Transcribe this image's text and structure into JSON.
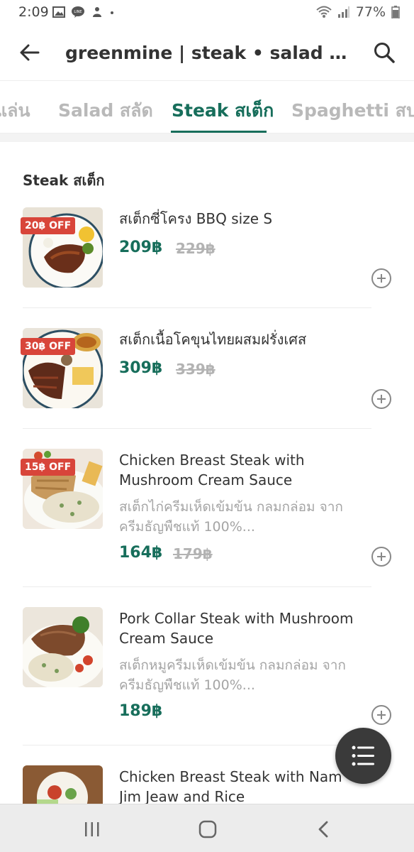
{
  "status_bar": {
    "time": "2:09",
    "battery": "77%",
    "left_icons": [
      "gallery-icon",
      "line-icon",
      "notification-icon",
      "dot-icon"
    ],
    "right_icons": [
      "wifi-icon",
      "signal-icon",
      "battery-icon"
    ]
  },
  "header": {
    "title": "greenmine | steak • salad • coff..."
  },
  "tabs": [
    {
      "label": "แล่น"
    },
    {
      "label": "Salad สลัด"
    },
    {
      "label": "Steak สเต็ก",
      "active": true
    },
    {
      "label": "Spaghetti สปา"
    }
  ],
  "section": {
    "title": "Steak สเต็ก"
  },
  "items": [
    {
      "badge": "20฿ OFF",
      "name": "สเต็กซี่โครง BBQ size S",
      "description": "",
      "price": "209฿",
      "old_price": "229฿"
    },
    {
      "badge": "30฿ OFF",
      "name": "สเต็กเนื้อโคขุนไทยผสมฝรั่งเศส",
      "description": "",
      "price": "309฿",
      "old_price": "339฿"
    },
    {
      "badge": "15฿ OFF",
      "name": "Chicken Breast Steak with Mushroom Cream Sauce",
      "description": "สเต็กไก่ครีมเห็ดเข้มข้น กลมกล่อม จากครีมธัญพืชแท้ 100%...",
      "price": "164฿",
      "old_price": "179฿"
    },
    {
      "badge": "",
      "name": "Pork Collar Steak with Mushroom Cream Sauce",
      "description": "สเต็กหมูครีมเห็ดเข้มข้น กลมกล่อม จากครีมธัญพืชแท้ 100%...",
      "price": "189฿",
      "old_price": ""
    },
    {
      "badge": "",
      "name": "Chicken Breast Steak with Nam Jim Jeaw and Rice",
      "description": "",
      "price": "",
      "old_price": ""
    }
  ],
  "colors": {
    "accent": "#176e5b",
    "badge": "#d8453a",
    "fab": "#3a3a3a"
  },
  "fab": {
    "icon": "menu-list-icon"
  },
  "nav_bar": {
    "icons": [
      "recent-apps-icon",
      "home-icon",
      "back-nav-icon"
    ]
  }
}
